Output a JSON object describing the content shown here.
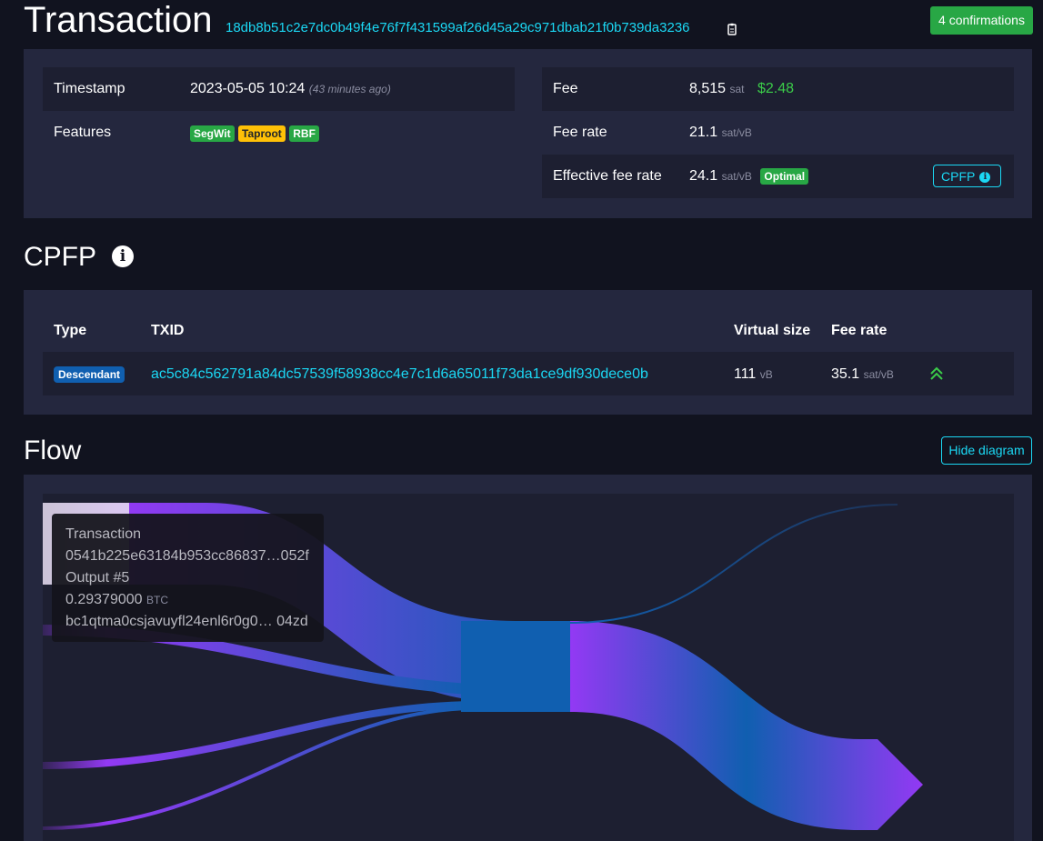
{
  "header": {
    "title": "Transaction",
    "txid": "18db8b51c2e7dc0b49f4e76f7f431599af26d45a29c971dbab21f0b739da3236",
    "confirmations": "4 confirmations"
  },
  "details": {
    "left": {
      "timestamp_label": "Timestamp",
      "timestamp_value": "2023-05-05 10:24",
      "timestamp_relative": "(43 minutes ago)",
      "features_label": "Features",
      "features": [
        "SegWit",
        "Taproot",
        "RBF"
      ]
    },
    "right": {
      "fee_label": "Fee",
      "fee_value": "8,515",
      "fee_unit": "sat",
      "fee_usd": "$2.48",
      "fee_rate_label": "Fee rate",
      "fee_rate_value": "21.1",
      "fee_rate_unit": "sat/vB",
      "eff_label": "Effective fee rate",
      "eff_value": "24.1",
      "eff_unit": "sat/vB",
      "eff_badge": "Optimal",
      "cpfp_button": "CPFP"
    }
  },
  "cpfp": {
    "title": "CPFP",
    "columns": [
      "Type",
      "TXID",
      "Virtual size",
      "Fee rate"
    ],
    "rows": [
      {
        "type": "Descendant",
        "txid": "ac5c84c562791a84dc57539f58938cc4e7c1d6a65011f73da1ce9df930dece0b",
        "vsize": "111",
        "vsize_unit": "vB",
        "fee_rate": "35.1",
        "fee_rate_unit": "sat/vB"
      }
    ]
  },
  "flow": {
    "title": "Flow",
    "hide_button": "Hide diagram",
    "tooltip": {
      "title": "Transaction",
      "txid": "0541b225e63184b953cc86837…052f",
      "output_label": "Output",
      "output_index": "#5",
      "amount": "0.29379000",
      "amount_unit": "BTC",
      "address": "bc1qtma0csjavuyfl24enl6r0g0… 04zd"
    }
  },
  "colors": {
    "background": "#11131f",
    "panel": "#24273e",
    "accent": "#1bd8f4",
    "success": "#28a745",
    "warning": "#ffc107",
    "flow_purple": "#9339f4",
    "flow_blue": "#105fb0"
  }
}
